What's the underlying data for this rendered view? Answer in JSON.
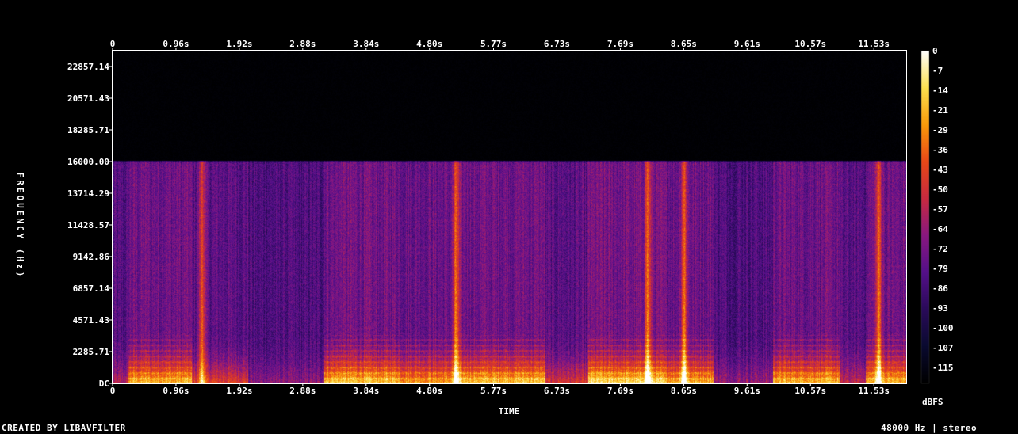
{
  "chart_data": {
    "type": "heatmap",
    "title": "",
    "xlabel": "TIME",
    "ylabel": "FREQUENCY (Hz)",
    "time_ticks": [
      "0",
      "0.96s",
      "1.92s",
      "2.88s",
      "3.84s",
      "4.80s",
      "5.77s",
      "6.73s",
      "7.69s",
      "8.65s",
      "9.61s",
      "10.57s",
      "11.53s"
    ],
    "time_tick_values": [
      0,
      0.96,
      1.92,
      2.88,
      3.84,
      4.8,
      5.77,
      6.73,
      7.69,
      8.65,
      9.61,
      10.57,
      11.53
    ],
    "xlim": [
      0,
      12.02
    ],
    "freq_ticks": [
      "DC",
      "2285.71",
      "4571.43",
      "6857.14",
      "9142.86",
      "11428.57",
      "13714.29",
      "16000.00",
      "18285.71",
      "20571.43",
      "22857.14"
    ],
    "freq_tick_values": [
      0,
      2285.71,
      4571.43,
      6857.14,
      9142.86,
      11428.57,
      13714.29,
      16000.0,
      18285.71,
      20571.43,
      22857.14
    ],
    "ylim": [
      0,
      24000
    ],
    "content_cutoff_hz": 16000,
    "colorbar": {
      "label": "dBFS",
      "ticks": [
        "0",
        "-7",
        "-14",
        "-21",
        "-29",
        "-36",
        "-43",
        "-50",
        "-57",
        "-64",
        "-72",
        "-79",
        "-86",
        "-93",
        "-100",
        "-107",
        "-115"
      ],
      "range": [
        -120,
        0
      ],
      "colormap": [
        "#000000",
        "#0a0a30",
        "#2a0a5a",
        "#55108a",
        "#8a1880",
        "#c82a40",
        "#e84818",
        "#f89a0a",
        "#fce050",
        "#ffffff"
      ]
    },
    "activity_segments": [
      {
        "start": 0.0,
        "end": 0.24,
        "level": 0.35
      },
      {
        "start": 0.24,
        "end": 1.2,
        "level": 0.85
      },
      {
        "start": 1.2,
        "end": 2.05,
        "level": 0.55
      },
      {
        "start": 2.05,
        "end": 3.2,
        "level": 0.25
      },
      {
        "start": 3.2,
        "end": 4.35,
        "level": 0.9
      },
      {
        "start": 4.35,
        "end": 5.25,
        "level": 0.8
      },
      {
        "start": 5.25,
        "end": 6.55,
        "level": 0.9
      },
      {
        "start": 6.55,
        "end": 7.2,
        "level": 0.5
      },
      {
        "start": 7.2,
        "end": 8.35,
        "level": 0.95
      },
      {
        "start": 8.35,
        "end": 9.1,
        "level": 0.85
      },
      {
        "start": 9.1,
        "end": 10.0,
        "level": 0.3
      },
      {
        "start": 10.0,
        "end": 11.0,
        "level": 0.85
      },
      {
        "start": 11.0,
        "end": 11.4,
        "level": 0.4
      },
      {
        "start": 11.4,
        "end": 12.02,
        "level": 0.85
      }
    ],
    "bright_streaks_s": [
      1.35,
      5.2,
      8.1,
      8.65,
      11.6
    ]
  },
  "footer": {
    "credit": "CREATED BY LIBAVFILTER",
    "format": "48000 Hz | stereo"
  }
}
